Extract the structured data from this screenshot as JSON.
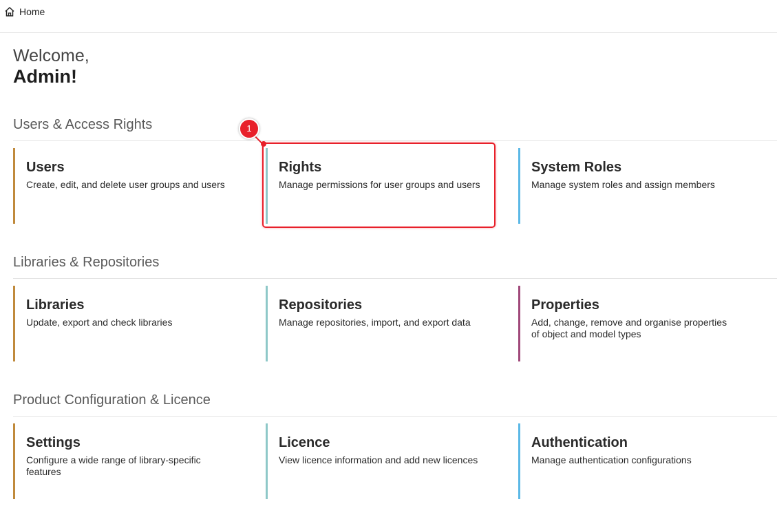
{
  "header": {
    "home_label": "Home"
  },
  "welcome": {
    "greeting": "Welcome,",
    "name": "Admin!"
  },
  "sections": [
    {
      "title": "Users & Access Rights",
      "cards": [
        {
          "title": "Users",
          "description": "Create, edit, and delete user groups and users",
          "accent": "#c08a3c"
        },
        {
          "title": "Rights",
          "description": "Manage permissions for user groups and users",
          "accent": "#8ec8c8"
        },
        {
          "title": "System Roles",
          "description": "Manage system roles and assign members",
          "accent": "#5bb8e6"
        }
      ]
    },
    {
      "title": "Libraries & Repositories",
      "cards": [
        {
          "title": "Libraries",
          "description": "Update, export and check libraries",
          "accent": "#c08a3c"
        },
        {
          "title": "Repositories",
          "description": "Manage repositories, import, and export data",
          "accent": "#8ec8c8"
        },
        {
          "title": "Properties",
          "description": "Add, change, remove and organise properties of object and model types",
          "accent": "#a0487a"
        }
      ]
    },
    {
      "title": "Product Configuration & Licence",
      "cards": [
        {
          "title": "Settings",
          "description": "Configure a wide range of library-specific features",
          "accent": "#c08a3c"
        },
        {
          "title": "Licence",
          "description": "View licence information and add new licences",
          "accent": "#8ec8c8"
        },
        {
          "title": "Authentication",
          "description": "Manage authentication configurations",
          "accent": "#5bb8e6"
        }
      ]
    }
  ],
  "annotation": {
    "marker_label": "1",
    "highlight_color": "#e8202a"
  }
}
